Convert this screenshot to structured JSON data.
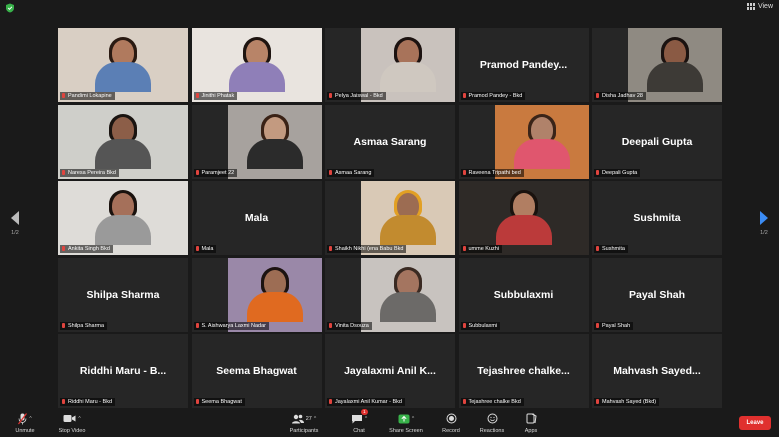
{
  "topbar": {
    "view_label": "View"
  },
  "gallery": {
    "tiles": [
      {
        "name": "Pandimi Lokapine",
        "big": "",
        "video": true
      },
      {
        "name": "Jinithi Phatak",
        "big": "",
        "video": true
      },
      {
        "name": "Pelya Jaiswal - Bkd",
        "big": "",
        "video": true
      },
      {
        "name": "Pramod Pandey - Bkd",
        "big": "Pramod Pandey...",
        "video": false
      },
      {
        "name": "Disha Jadhav 28",
        "big": "",
        "video": true
      },
      {
        "name": "Naresa Pereira Bkd",
        "big": "",
        "video": true
      },
      {
        "name": "Paramjeet 22",
        "big": "",
        "video": true
      },
      {
        "name": "Asmaa Sarang",
        "big": "Asmaa Sarang",
        "video": false
      },
      {
        "name": "Raveena Tripathi bed",
        "big": "",
        "video": true
      },
      {
        "name": "Deepali Gupta",
        "big": "Deepali Gupta",
        "video": false
      },
      {
        "name": "Ankita Singh Bkd",
        "big": "",
        "video": true,
        "active": true
      },
      {
        "name": "Mala",
        "big": "Mala",
        "video": false
      },
      {
        "name": "Shaikh Nikhi (ena Babu Bkd",
        "big": "",
        "video": true
      },
      {
        "name": "umme Kuzhi",
        "big": "",
        "video": true
      },
      {
        "name": "Sushmita",
        "big": "Sushmita",
        "video": false
      },
      {
        "name": "Shilpa Sharma",
        "big": "Shilpa Sharma",
        "video": false
      },
      {
        "name": "S. Aishwarya Laxmi Nadar",
        "big": "",
        "video": true
      },
      {
        "name": "Vinita Dsouza",
        "big": "",
        "video": true
      },
      {
        "name": "Subbulaxmi",
        "big": "Subbulaxmi",
        "video": false
      },
      {
        "name": "Payal Shah",
        "big": "Payal Shah",
        "video": false
      },
      {
        "name": "Riddhi Maru - Bkd",
        "big": "Riddhi Maru - B...",
        "video": false
      },
      {
        "name": "Seema Bhagwat",
        "big": "Seema Bhagwat",
        "video": false
      },
      {
        "name": "Jayalaxmi Anil Kumar - Bkd",
        "big": "Jayalaxmi Anil K...",
        "video": false
      },
      {
        "name": "Tejashree chalke Bkd",
        "big": "Tejashree chalke...",
        "video": false
      },
      {
        "name": "Mahvash Sayed (Bkd)",
        "big": "Mahvash Sayed...",
        "video": false
      }
    ]
  },
  "pagination": {
    "left_count": "1/2",
    "right_count": "1/2"
  },
  "toolbar": {
    "unmute": "Unmute",
    "stop_video": "Stop Video",
    "participants": "Participants",
    "participants_count": "27",
    "chat": "Chat",
    "chat_badge": "1",
    "share_screen": "Share Screen",
    "record": "Record",
    "reactions": "Reactions",
    "apps": "Apps",
    "leave": "Leave"
  }
}
